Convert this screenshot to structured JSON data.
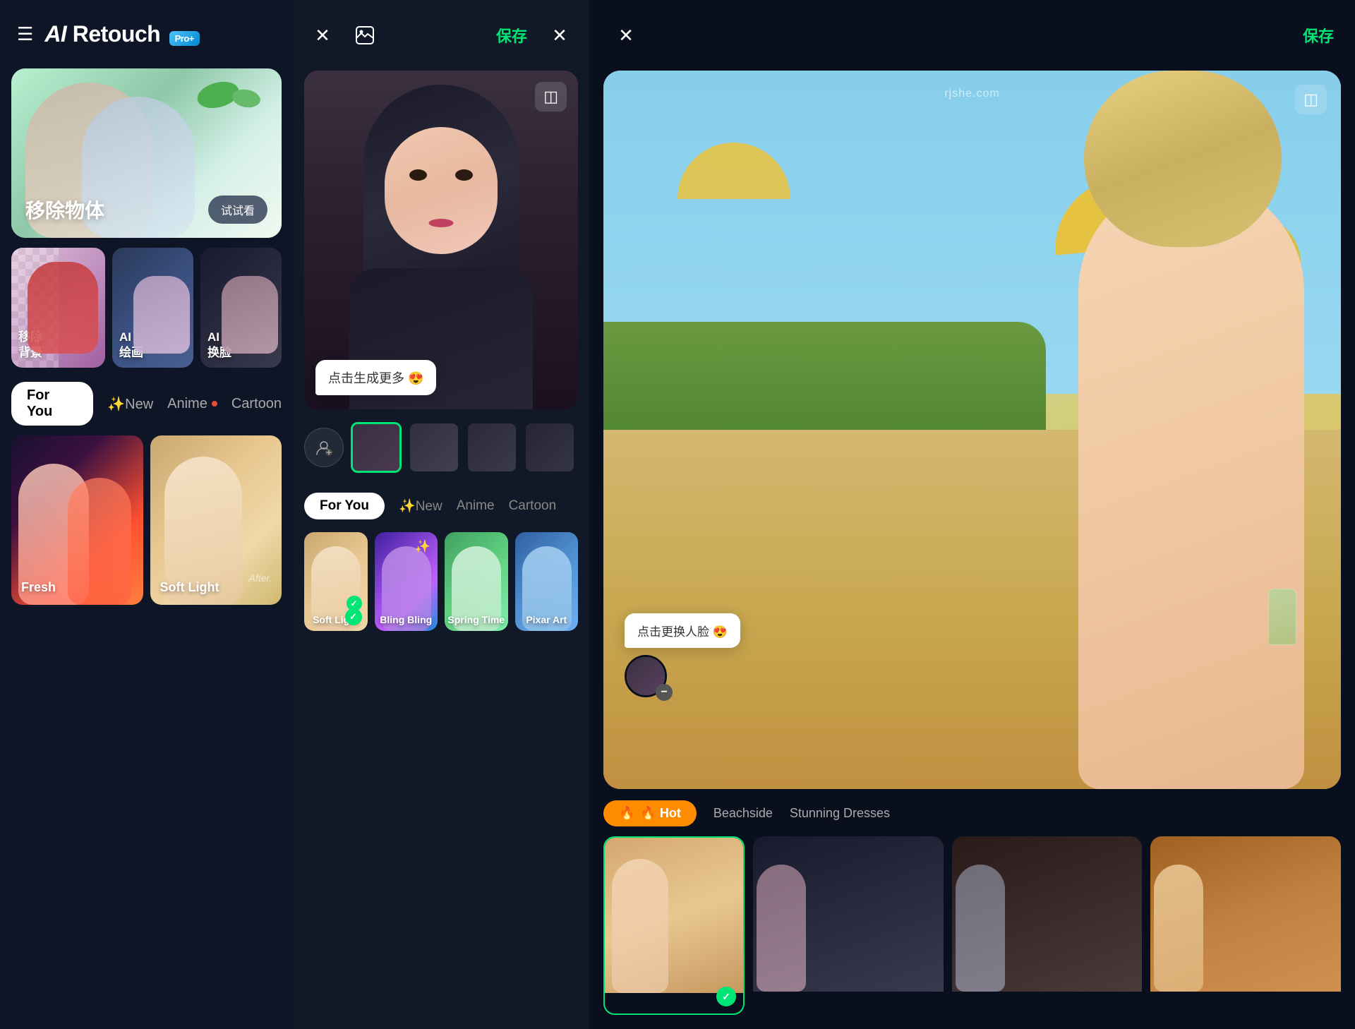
{
  "app": {
    "name": "AI Retouch",
    "pro_badge": "Pro+",
    "menu_icon": "☰"
  },
  "left_panel": {
    "banner": {
      "title": "移除物体",
      "try_btn": "试试看"
    },
    "features": [
      {
        "label": "移除\n背景",
        "type": "large"
      },
      {
        "label": "AI\n绘画",
        "type": "medium"
      },
      {
        "label": "AI\n换脸",
        "type": "medium"
      }
    ],
    "tabs": [
      {
        "label": "For You",
        "active": true
      },
      {
        "label": "✨New",
        "active": false,
        "has_dot": false
      },
      {
        "label": "Anime",
        "active": false,
        "has_dot": true
      },
      {
        "label": "Cartoon",
        "active": false
      }
    ],
    "content": [
      {
        "label": "Fresh"
      },
      {
        "label": "Soft Light",
        "has_after": true
      }
    ]
  },
  "middle_panel": {
    "header": {
      "close_icon": "✕",
      "image_icon": "⊞",
      "save_label": "保存",
      "close2_icon": "✕"
    },
    "chat_bubble": "点击生成更多 😍",
    "compare_icon": "◫",
    "tabs": [
      {
        "label": "For You",
        "active": true
      },
      {
        "label": "✨New",
        "active": false
      },
      {
        "label": "Anime",
        "active": false
      },
      {
        "label": "Cartoon",
        "active": false
      }
    ],
    "styles": [
      {
        "name": "Soft Light",
        "selected": true
      },
      {
        "name": "Bling Bling",
        "selected": false
      },
      {
        "name": "Spring Time",
        "selected": false
      },
      {
        "name": "Pixar Art",
        "selected": false
      }
    ]
  },
  "right_panel": {
    "header": {
      "close_icon": "✕",
      "save_label": "保存"
    },
    "watermark": "rjshe.com",
    "compare_icon": "◫",
    "chat_bubble": "点击更换人脸 😍",
    "tabs": [
      {
        "label": "🔥 Hot",
        "active": true
      },
      {
        "label": "Beachside",
        "active": false
      },
      {
        "label": "Stunning Dresses",
        "active": false
      }
    ]
  }
}
